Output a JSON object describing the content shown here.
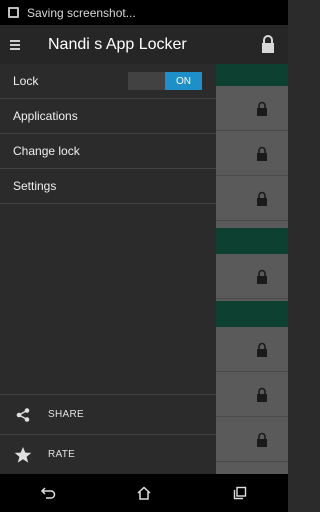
{
  "status_bar": {
    "notification_text": "Saving screenshot..."
  },
  "app_bar": {
    "title": "Nandi s App Locker"
  },
  "drawer": {
    "items": [
      {
        "label": "Lock",
        "toggle": {
          "state": "ON"
        }
      },
      {
        "label": "Applications"
      },
      {
        "label": "Change lock"
      },
      {
        "label": "Settings"
      }
    ],
    "bottom": [
      {
        "label": "SHARE",
        "icon": "share-icon"
      },
      {
        "label": "RATE",
        "icon": "star-icon"
      }
    ]
  },
  "colors": {
    "accent": "#1e8fc9",
    "header_green": "#0d4030",
    "drawer_bg": "#2b2b2b"
  },
  "nav_bar": {
    "icons": [
      "back-icon",
      "home-icon",
      "recents-icon"
    ]
  }
}
